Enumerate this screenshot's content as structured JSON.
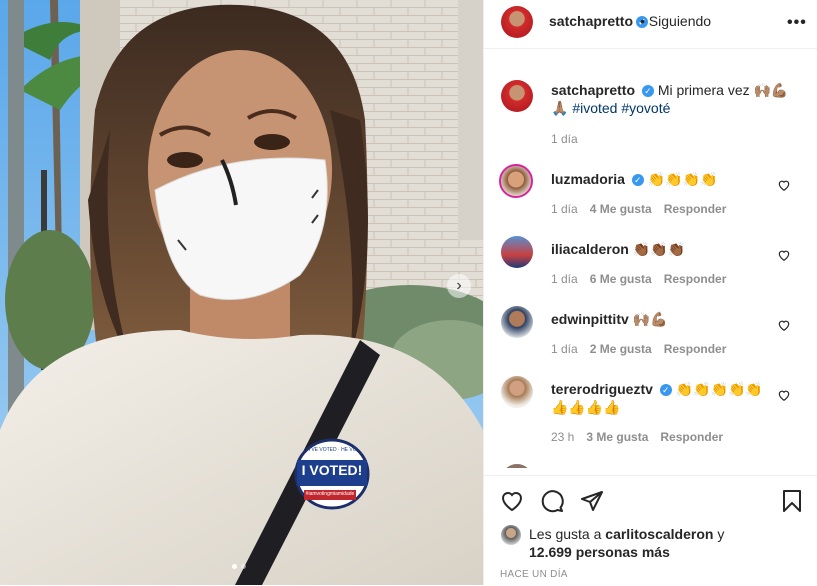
{
  "header": {
    "username": "satchapretto",
    "separator": "•",
    "follow_status": "Siguiendo",
    "more_label": "•••"
  },
  "caption": {
    "username": "satchapretto",
    "text": "Mi primera vez 🙌🏽💪🏽",
    "line2_emoji": "🙏🏽",
    "hashtags": "#ivoted #yovoté",
    "time": "1 día"
  },
  "comments": [
    {
      "username": "luzmadoria",
      "text": "👏👏👏👏",
      "time": "1 día",
      "likes": "4 Me gusta",
      "reply": "Responder"
    },
    {
      "username": "iliacalderon",
      "text": "👏🏾👏🏾👏🏾",
      "time": "1 día",
      "likes": "6 Me gusta",
      "reply": "Responder"
    },
    {
      "username": "edwinpittitv",
      "text": "🙌🏽💪🏽",
      "time": "1 día",
      "likes": "2 Me gusta",
      "reply": "Responder"
    },
    {
      "username": "tererodrigueztv",
      "text": "👏👏👏👏👏",
      "text2": "👍👍👍👍",
      "time": "23 h",
      "likes": "3 Me gusta",
      "reply": "Responder"
    }
  ],
  "likes": {
    "prefix": "Les gusta a",
    "user": "carlitoscalderon",
    "conj": "y",
    "count": "12.699 personas más"
  },
  "time_ago": "HACE UN DÍA",
  "sticker": {
    "top": "I'VE VOTED · HE VOTADO",
    "main": "I VOTED!",
    "bottom": "#iamvotingmiamidade"
  },
  "colors": {
    "verified": "#3897f0",
    "hashtag": "#00376b",
    "secondary_text": "#8e8e8e"
  }
}
